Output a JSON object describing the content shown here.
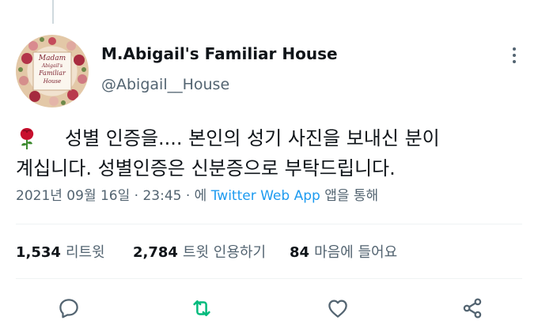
{
  "tweet": {
    "display_name": "M.Abigail's Familiar House",
    "handle": "@Abigail__House",
    "avatar_text": {
      "line1": "Madam",
      "line2": "Abigail's",
      "line3": "Familiar",
      "line4": "House"
    },
    "text_line1": "성별 인증을.... 본인의 성기 사진을 보내신 분이",
    "text_line2": "계십니다. 성별인증은 신분증으로 부탁드립니다.",
    "emoji": "rose",
    "timestamp": "2021년 09월 16일 · 23:45 · 에",
    "source_app": "Twitter Web App",
    "source_suffix": "앱을 통해"
  },
  "stats": {
    "retweets_count": "1,534",
    "retweets_label": "리트윗",
    "quotes_count": "2,784",
    "quotes_label": "트윗 인용하기",
    "likes_count": "84",
    "likes_label": "마음에 들어요"
  },
  "actions": {
    "reply_icon": "reply-icon",
    "retweet_icon": "retweet-icon",
    "like_icon": "heart-icon",
    "share_icon": "share-icon"
  },
  "colors": {
    "accent": "#1d9bf0",
    "retweet": "#00ba7c",
    "secondary_text": "#536471",
    "icon": "#536471"
  }
}
